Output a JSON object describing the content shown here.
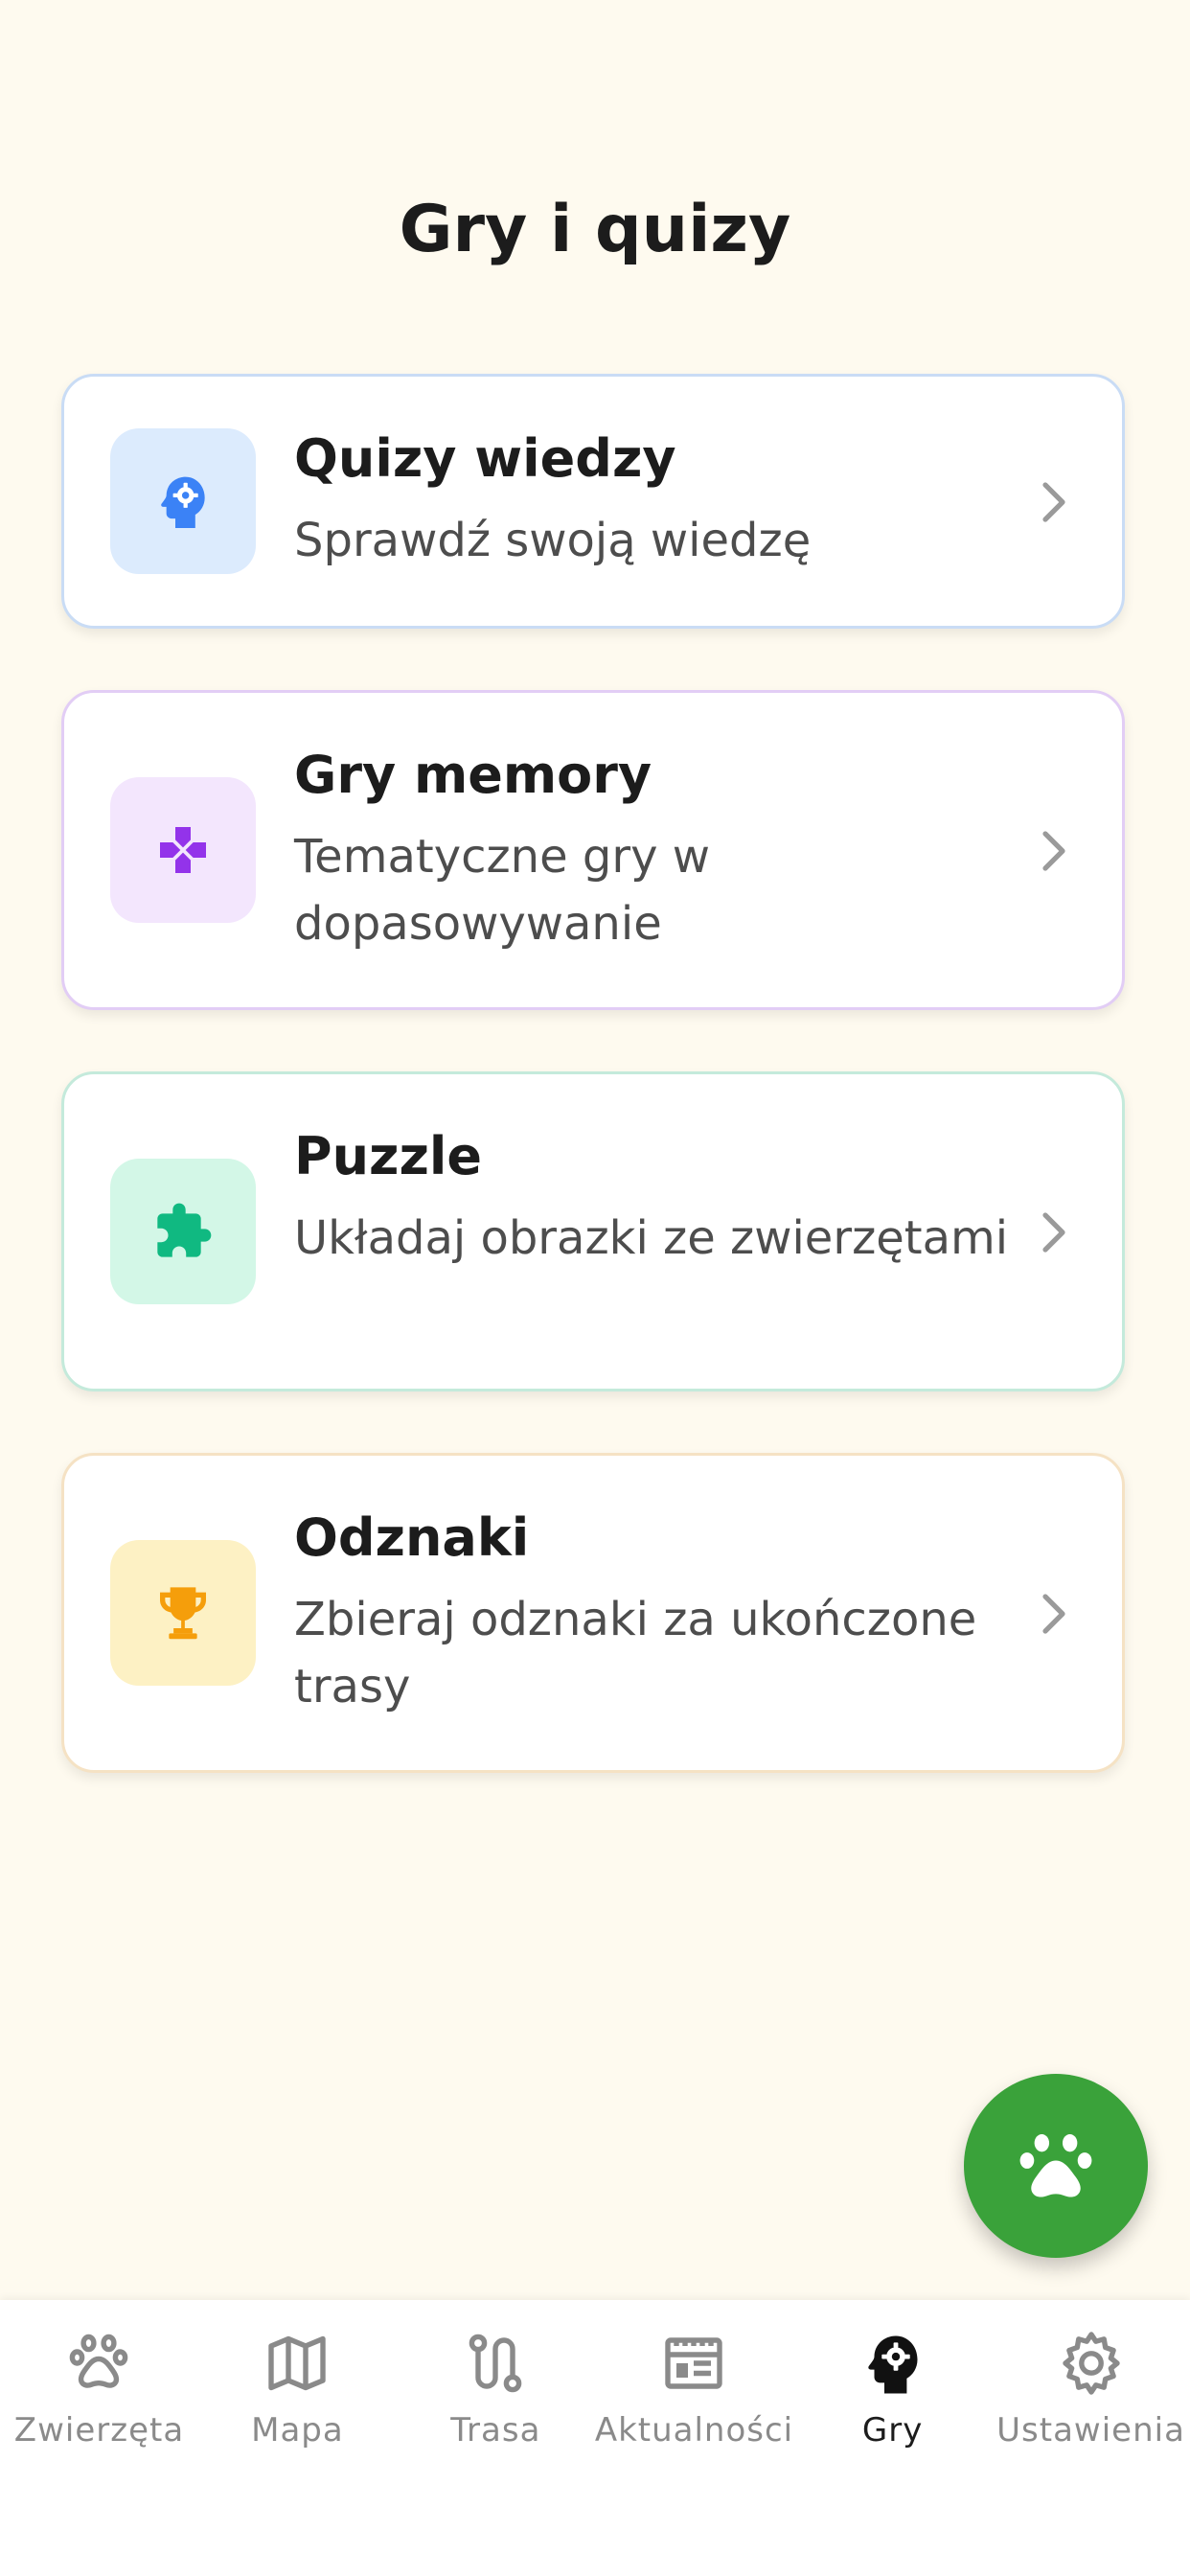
{
  "header": {
    "title": "Gry i quizy"
  },
  "cards": [
    {
      "title": "Quizy wiedzy",
      "subtitle": "Sprawdź swoją wiedzę",
      "icon": "head-gear-icon",
      "accent": "#3b82f6",
      "icon_bg": "#dcebfd",
      "border": "#c9dcf5"
    },
    {
      "title": "Gry memory",
      "subtitle": "Tematyczne gry w dopasowywanie",
      "icon": "gamepad-icon",
      "accent": "#9333ea",
      "icon_bg": "#f3e6fd",
      "border": "#e2cdf5"
    },
    {
      "title": "Puzzle",
      "subtitle": "Układaj obrazki ze zwierzętami",
      "icon": "puzzle-icon",
      "accent": "#10b981",
      "icon_bg": "#d3f7e7",
      "border": "#c4eadb"
    },
    {
      "title": "Odznaki",
      "subtitle": "Zbieraj odznaki za ukończone trasy",
      "icon": "trophy-icon",
      "accent": "#f59e0b",
      "icon_bg": "#fdf1c4",
      "border": "#f5e2c4"
    }
  ],
  "fab": {
    "icon": "paw-icon",
    "color": "#3aa23a"
  },
  "nav": {
    "items": [
      {
        "label": "Zwierzęta",
        "icon": "paw-icon",
        "active": false
      },
      {
        "label": "Mapa",
        "icon": "map-icon",
        "active": false
      },
      {
        "label": "Trasa",
        "icon": "route-icon",
        "active": false
      },
      {
        "label": "Aktualności",
        "icon": "newspaper-icon",
        "active": false
      },
      {
        "label": "Gry",
        "icon": "head-gear-icon",
        "active": true
      },
      {
        "label": "Ustawienia",
        "icon": "gear-icon",
        "active": false
      }
    ]
  }
}
